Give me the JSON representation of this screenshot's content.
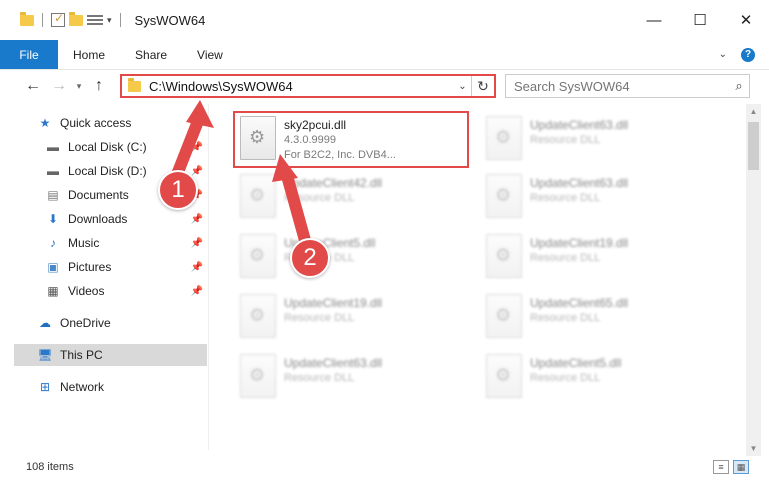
{
  "window": {
    "title": "SysWOW64",
    "minimize": "—",
    "maximize": "☐",
    "close": "✕"
  },
  "ribbon": {
    "file": "File",
    "tabs": [
      "Home",
      "Share",
      "View"
    ]
  },
  "nav": {
    "address": "C:\\Windows\\SysWOW64",
    "search_placeholder": "Search SysWOW64"
  },
  "sidebar": {
    "items": [
      {
        "label": "Quick access",
        "icon": "star-icon",
        "pinned": false
      },
      {
        "label": "Local Disk (C:)",
        "icon": "drive-icon",
        "pinned": true
      },
      {
        "label": "Local Disk (D:)",
        "icon": "drive-icon",
        "pinned": true
      },
      {
        "label": "Documents",
        "icon": "documents-icon",
        "pinned": true
      },
      {
        "label": "Downloads",
        "icon": "download-icon",
        "pinned": true
      },
      {
        "label": "Music",
        "icon": "music-icon",
        "pinned": true
      },
      {
        "label": "Pictures",
        "icon": "pictures-icon",
        "pinned": true
      },
      {
        "label": "Videos",
        "icon": "videos-icon",
        "pinned": true
      },
      {
        "label": "OneDrive",
        "icon": "cloud-icon",
        "pinned": false
      },
      {
        "label": "This PC",
        "icon": "computer-icon",
        "pinned": false,
        "selected": true
      },
      {
        "label": "Network",
        "icon": "network-icon",
        "pinned": false
      }
    ]
  },
  "files": [
    {
      "name": "sky2pcui.dll",
      "line2": "4.3.0.9999",
      "line3": "For B2C2, Inc. DVB4...",
      "highlighted": true
    },
    {
      "name": "UpdateClient63.dll",
      "line2": "Resource DLL"
    },
    {
      "name": "UpdateClient42.dll",
      "line2": "Resource DLL"
    },
    {
      "name": "UpdateClient63.dll",
      "line2": "Resource DLL"
    },
    {
      "name": "UpdateClient5.dll",
      "line2": "Resource DLL"
    },
    {
      "name": "UpdateClient19.dll",
      "line2": "Resource DLL"
    },
    {
      "name": "UpdateClient19.dll",
      "line2": "Resource DLL"
    },
    {
      "name": "UpdateClient65.dll",
      "line2": "Resource DLL"
    },
    {
      "name": "UpdateClient63.dll",
      "line2": "Resource DLL"
    },
    {
      "name": "UpdateClient5.dll",
      "line2": "Resource DLL"
    }
  ],
  "status": {
    "items": "108 items"
  },
  "annotations": {
    "step1": "1",
    "step2": "2",
    "color": "#e24a4a"
  }
}
